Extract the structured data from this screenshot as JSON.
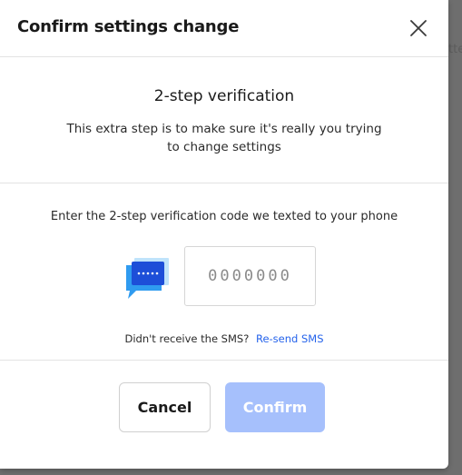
{
  "backdrop": {
    "fragment": "tte"
  },
  "dialog": {
    "title": "Confirm settings change",
    "close_icon": "close-icon"
  },
  "verification": {
    "heading": "2-step verification",
    "description": "This extra step is to make sure it's really you trying to change settings"
  },
  "code_entry": {
    "instruction": "Enter the 2-step verification code we texted to your phone",
    "sms_icon": "sms-message-icon",
    "input_placeholder": "0000000",
    "input_value": "",
    "resend_prompt": "Didn't receive the SMS?",
    "resend_link": "Re-send SMS"
  },
  "actions": {
    "cancel_label": "Cancel",
    "confirm_label": "Confirm",
    "confirm_disabled": true
  },
  "colors": {
    "link": "#2563eb",
    "confirm_disabled_bg": "#a6c0fc",
    "icon_blue": "#1d4ed8",
    "icon_light": "#bfe3fb"
  }
}
